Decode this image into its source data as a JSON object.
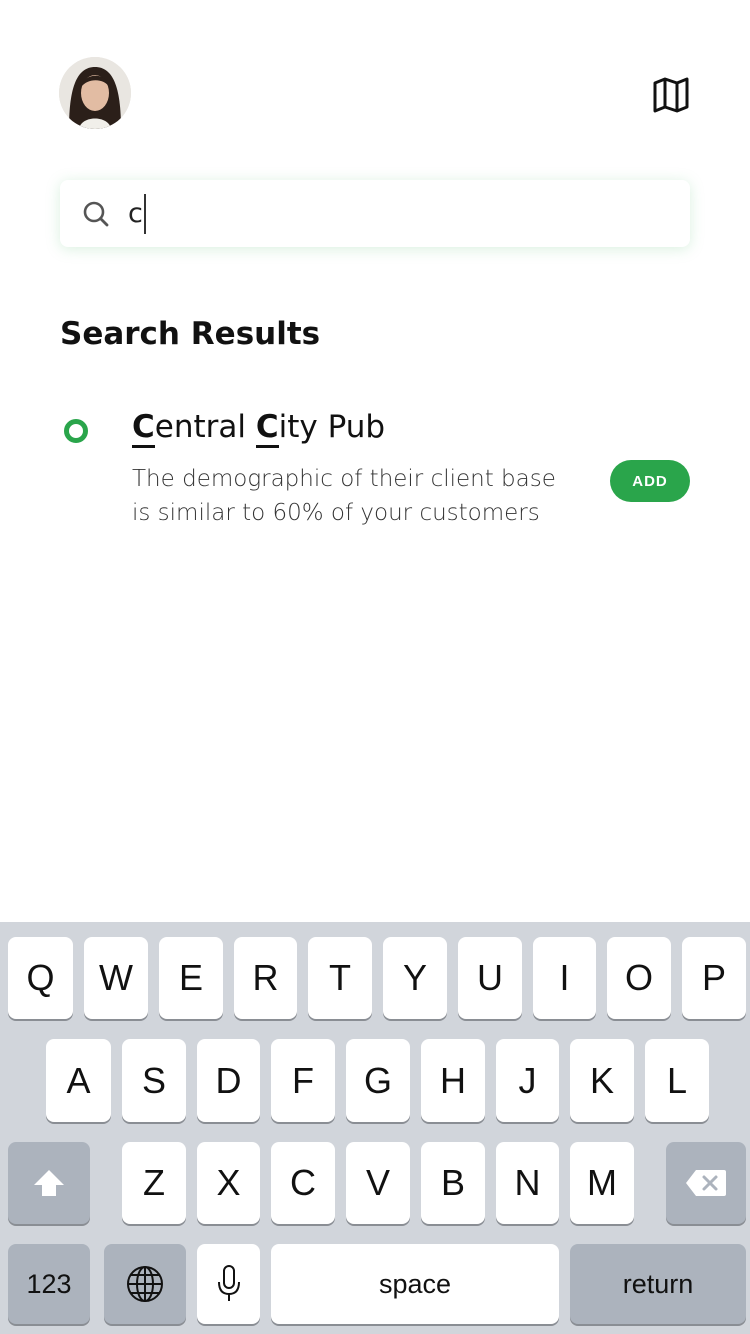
{
  "header": {
    "avatar_icon": "user-avatar",
    "map_icon": "map-icon"
  },
  "search": {
    "value": "c",
    "icon": "search-icon"
  },
  "results": {
    "title": "Search Results",
    "items": [
      {
        "name_parts": [
          "C",
          "entral ",
          "C",
          "ity Pub"
        ],
        "description": "The demographic of their client base is similar to 60% of your customers",
        "action_label": "ADD"
      }
    ]
  },
  "keyboard": {
    "row1": [
      "Q",
      "W",
      "E",
      "R",
      "T",
      "Y",
      "U",
      "I",
      "O",
      "P"
    ],
    "row2": [
      "A",
      "S",
      "D",
      "F",
      "G",
      "H",
      "J",
      "K",
      "L"
    ],
    "row3": [
      "Z",
      "X",
      "C",
      "V",
      "B",
      "N",
      "M"
    ],
    "numbers_label": "123",
    "space_label": "space",
    "return_label": "return",
    "shift_icon": "shift-icon",
    "backspace_icon": "backspace-icon",
    "globe_icon": "globe-icon",
    "mic_icon": "microphone-icon"
  },
  "colors": {
    "accent": "#2aa54b",
    "keyboard_bg": "#d1d5db",
    "dark_key": "#acb3bd"
  }
}
